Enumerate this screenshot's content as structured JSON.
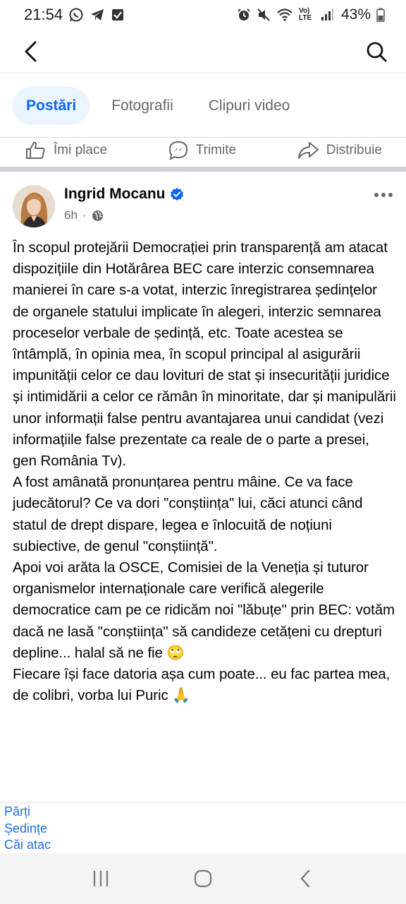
{
  "status_bar": {
    "time": "21:54",
    "battery": "43%",
    "network": "Vo) LTE"
  },
  "tabs": [
    {
      "label": "Postări",
      "active": true
    },
    {
      "label": "Fotografii",
      "active": false
    },
    {
      "label": "Clipuri video",
      "active": false
    }
  ],
  "actions": {
    "like": "Îmi place",
    "send": "Trimite",
    "share": "Distribuie"
  },
  "post": {
    "author": "Ingrid Mocanu",
    "verified": true,
    "time": "6h",
    "separator": "·",
    "paragraphs": [
      "În scopul protejării Democrației prin transparență am atacat dispozițiile din Hotărârea BEC care interzic consemnarea manierei în care s-a votat, interzic înregistrarea ședințelor de organele statului implicate în alegeri, interzic semnarea proceselor verbale de ședință, etc. Toate acestea se întâmplă, în opinia mea, în scopul principal al asigurării impunității celor ce dau lovituri de stat și insecurității juridice și intimidării a celor ce rămân în minoritate, dar și manipulării unor informații false pentru avantajarea unui candidat (vezi informațiile false prezentate ca reale de o parte a presei, gen România Tv).",
      "A fost amânată pronunțarea pentru mâine. Ce va face judecătorul? Ce va dori \"conștiința\" lui, căci atunci când statul de drept dispare, legea e înlocuită de noțiuni subiective, de genul \"conștiință\".",
      "Apoi voi arăta la OSCE, Comisiei de la Veneția și tuturor organismelor internaționale care verifică alegerile democratice cam pe ce ridicăm noi \"lăbuțe\" prin BEC: votăm dacă ne lasă \"conștiința\" să candideze cetățeni cu drepturi depline... halal să ne fie 🙄",
      "Fiecare își face datoria așa cum poate... eu fac partea mea, de colibri, vorba lui Puric 🙏"
    ]
  },
  "footer_links": [
    "Părți",
    "Ședințe",
    "Căi atac"
  ],
  "colors": {
    "accent": "#0866ff",
    "verified": "#0866ff",
    "link": "#216fdb",
    "secondary_text": "#65676b"
  },
  "icons": {
    "back": "back-arrow-icon",
    "search": "search-icon",
    "like": "thumbs-up-icon",
    "send": "messenger-send-icon",
    "share": "share-arrow-icon",
    "privacy": "globe-icon",
    "more": "more-dots-icon"
  }
}
